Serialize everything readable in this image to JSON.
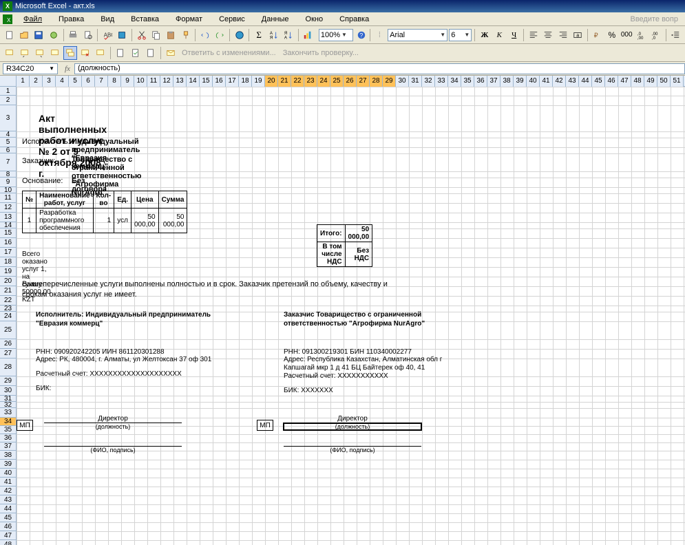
{
  "title": "Microsoft Excel - акт.xls",
  "menu": [
    "Файл",
    "Правка",
    "Вид",
    "Вставка",
    "Формат",
    "Сервис",
    "Данные",
    "Окно",
    "Справка"
  ],
  "helpPrompt": "Введите вопр",
  "zoom": "100%",
  "font": "Arial",
  "fontSize": "6",
  "nameBox": "R34C20",
  "formulaValue": "(должность)",
  "reviewText1": "Ответить с изменениями...",
  "reviewText2": "Закончить проверку...",
  "colHeaders": [
    "1",
    "2",
    "3",
    "4",
    "5",
    "6",
    "7",
    "8",
    "9",
    "10",
    "11",
    "12",
    "13",
    "14",
    "15",
    "16",
    "17",
    "18",
    "19",
    "20",
    "21",
    "22",
    "23",
    "24",
    "25",
    "26",
    "27",
    "28",
    "29",
    "30",
    "31",
    "32",
    "33",
    "34",
    "35",
    "36",
    "37",
    "38",
    "39",
    "40",
    "41",
    "42",
    "43",
    "44",
    "45",
    "46",
    "47",
    "48",
    "49",
    "50",
    "51"
  ],
  "rowHeaders": [
    "1",
    "2",
    "3",
    "4",
    "5",
    "6",
    "7",
    "8",
    "9",
    "10",
    "11",
    "12",
    "13",
    "14",
    "15",
    "16",
    "17",
    "18",
    "19",
    "20",
    "21",
    "22",
    "23",
    "24",
    "25",
    "26",
    "27",
    "28",
    "29",
    "30",
    "31",
    "32",
    "33",
    "34",
    "35",
    "36",
    "37",
    "38",
    "39",
    "40",
    "41",
    "42",
    "43",
    "44",
    "45",
    "46",
    "47",
    "48"
  ],
  "selectedCols": [
    "20",
    "21",
    "22",
    "23",
    "24",
    "25",
    "26",
    "27",
    "28",
    "29"
  ],
  "selectedRow": "34",
  "doc": {
    "title": "Акт выполненных работ и услуг   № 2 от 9 октября 2008 г.",
    "executor_label": "Исполнитель:",
    "executor": "Индивидуальный предприниматель \"Евразия коммерц\"",
    "customer_label": "Заказчик:",
    "customer": "Товарищество с ограниченной ответственностью \"Агрофирма NurAgro\"",
    "basis_label": "Основание:",
    "basis": "Без договора",
    "table_headers": [
      "№",
      "Наименование работ, услуг",
      "Кол-во",
      "Ед.",
      "Цена",
      "Сумма"
    ],
    "table_row": [
      "1",
      "Разработка программного обеспечения",
      "1",
      "усл",
      "50 000,00",
      "50 000,00"
    ],
    "total_label": "Итого:",
    "total_value": "50 000,00",
    "nds_label": "В том числе НДС",
    "nds_value": "Без НДС",
    "summary": "Всего оказано услуг 1, на сумму 50000,00 KZT",
    "statement": "Вышеперечисленные услуги выполнены полностью и в срок. Заказчик претензий по объему, качеству и срокам оказания услуг не имеет.",
    "sig_left_title": "Исполнитель: Индивидуальный предприниматель \"Евразия коммерц\"",
    "sig_right_title": "Заказчис  Товарищество с ограниченной ответственностью \"Агрофирма NurAgro\"",
    "left_rnn": "РНН: 090920242205   ИИН 861120301288",
    "left_addr": "Адрес: РК,  480004,  г. Алматы,    ул Желтоксан 37 оф 301",
    "left_acct": "Расчетный счет: XXXXXXXXXXXXXXXXXXXX",
    "left_bik": "БИК:",
    "right_rnn": "РНН: 091300219301   БИН 110340002277",
    "right_addr": "Адрес: Республика Казахстан, Алматинская обл г Капшагай мкр 1 д 41  БЦ Байтерек  оф 40, 41",
    "right_acct": "Расчетный счет: XXXXXXXXXXX",
    "right_bik": "БИК: XXXXXXX",
    "mp": "МП",
    "director": "Директор",
    "position": "(должность)",
    "fio": "(ФИО, подпись)"
  }
}
